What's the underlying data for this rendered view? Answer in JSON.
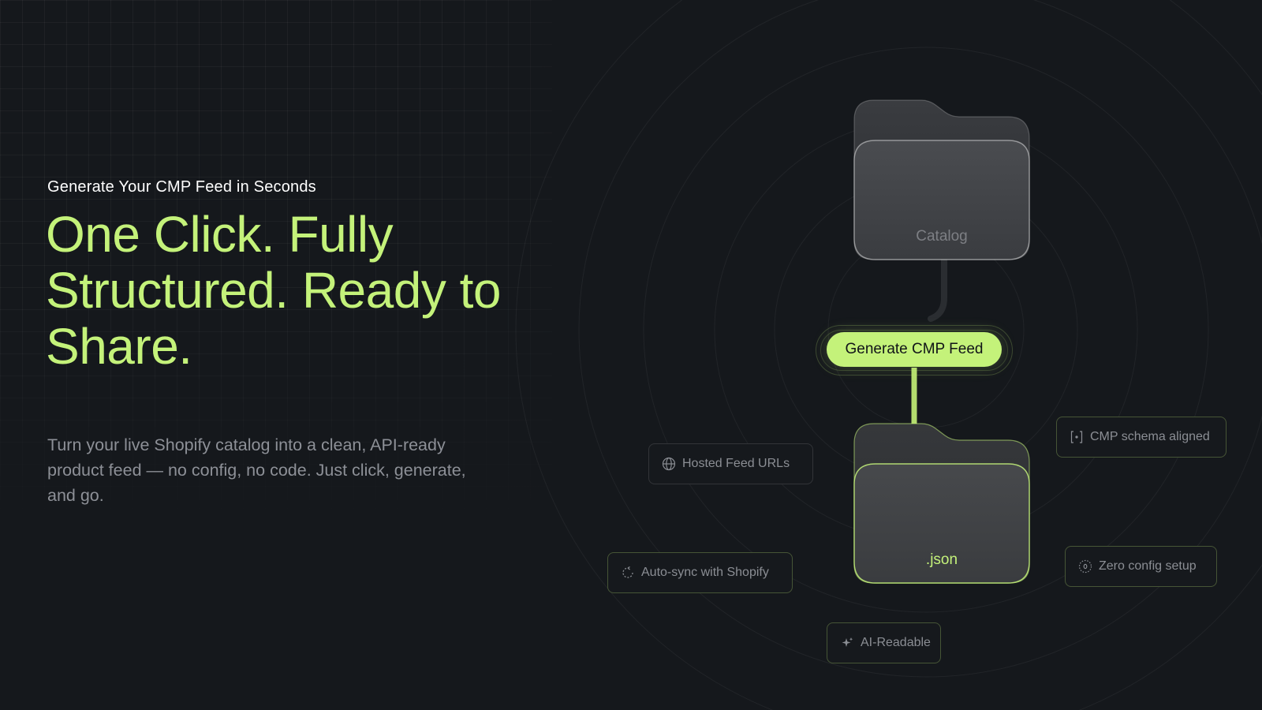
{
  "hero": {
    "eyebrow": "Generate Your CMP Feed in Seconds",
    "headline": "One Click. Fully Structured. Ready to Share.",
    "lead": "Turn your live Shopify catalog into a clean, API-ready product feed — no config, no code. Just click, generate, and go."
  },
  "diagram": {
    "source_folder_label": "Catalog",
    "output_folder_label": ".json",
    "action_button_label": "Generate CMP Feed",
    "features": {
      "hosted": {
        "label": "Hosted Feed URLs",
        "icon": "globe-icon"
      },
      "schema": {
        "label": "CMP schema aligned",
        "icon": "brackets-icon"
      },
      "autosync": {
        "label": "Auto-sync with Shopify",
        "icon": "sync-icon"
      },
      "zeroconfig": {
        "label": "Zero config setup",
        "icon": "zero-icon"
      },
      "ai": {
        "label": "AI-Readable",
        "icon": "sparkle-icon"
      }
    }
  },
  "colors": {
    "background": "#15181c",
    "accent": "#c4f27a",
    "muted_text": "#8d9097"
  }
}
